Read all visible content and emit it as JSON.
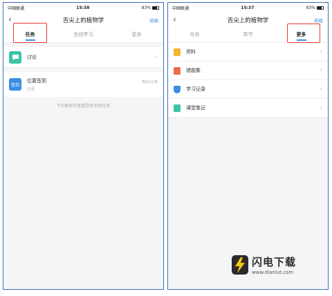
{
  "status_left": {
    "carrier": "中国联通 ",
    "time": "15:38",
    "battery": "83%"
  },
  "status_right": {
    "carrier": "中国联通 ",
    "time": "15:37",
    "battery": "83%"
  },
  "left_screen": {
    "back": "‹",
    "title": "舌尖上的植物学",
    "class_link": "班级",
    "tabs": [
      "任务",
      "在线学习",
      "更多"
    ],
    "items": {
      "discussion": {
        "label": "讨论",
        "icon_color": "#3cc5a8"
      },
      "checkin": {
        "icon_text": "签到",
        "label": "位置签到",
        "status": "已签",
        "note": "剩余1分钟",
        "icon_color": "#3a8ee6"
      }
    },
    "hint": "下拉刷新可查看是否有新任务"
  },
  "right_screen": {
    "back": "‹",
    "title": "舌尖上的植物学",
    "class_link": "班级",
    "tabs": [
      "任务",
      "章节",
      "更多"
    ],
    "items": [
      {
        "label": "资料",
        "icon": "folder-icon",
        "color": "#f5b52e"
      },
      {
        "label": "错题集",
        "icon": "wrong-questions-icon",
        "color": "#ef6b4e"
      },
      {
        "label": "学习记录",
        "icon": "shield-icon",
        "color": "#3a8ee6"
      },
      {
        "label": "课堂笔记",
        "icon": "note-icon",
        "color": "#3cc5a8"
      }
    ]
  },
  "watermark": {
    "title": "闪电下载",
    "url": "www.dianlut.com"
  },
  "colors": {
    "accent": "#3a8ee6",
    "highlight": "#e53935",
    "frame": "#3d6fb4"
  }
}
